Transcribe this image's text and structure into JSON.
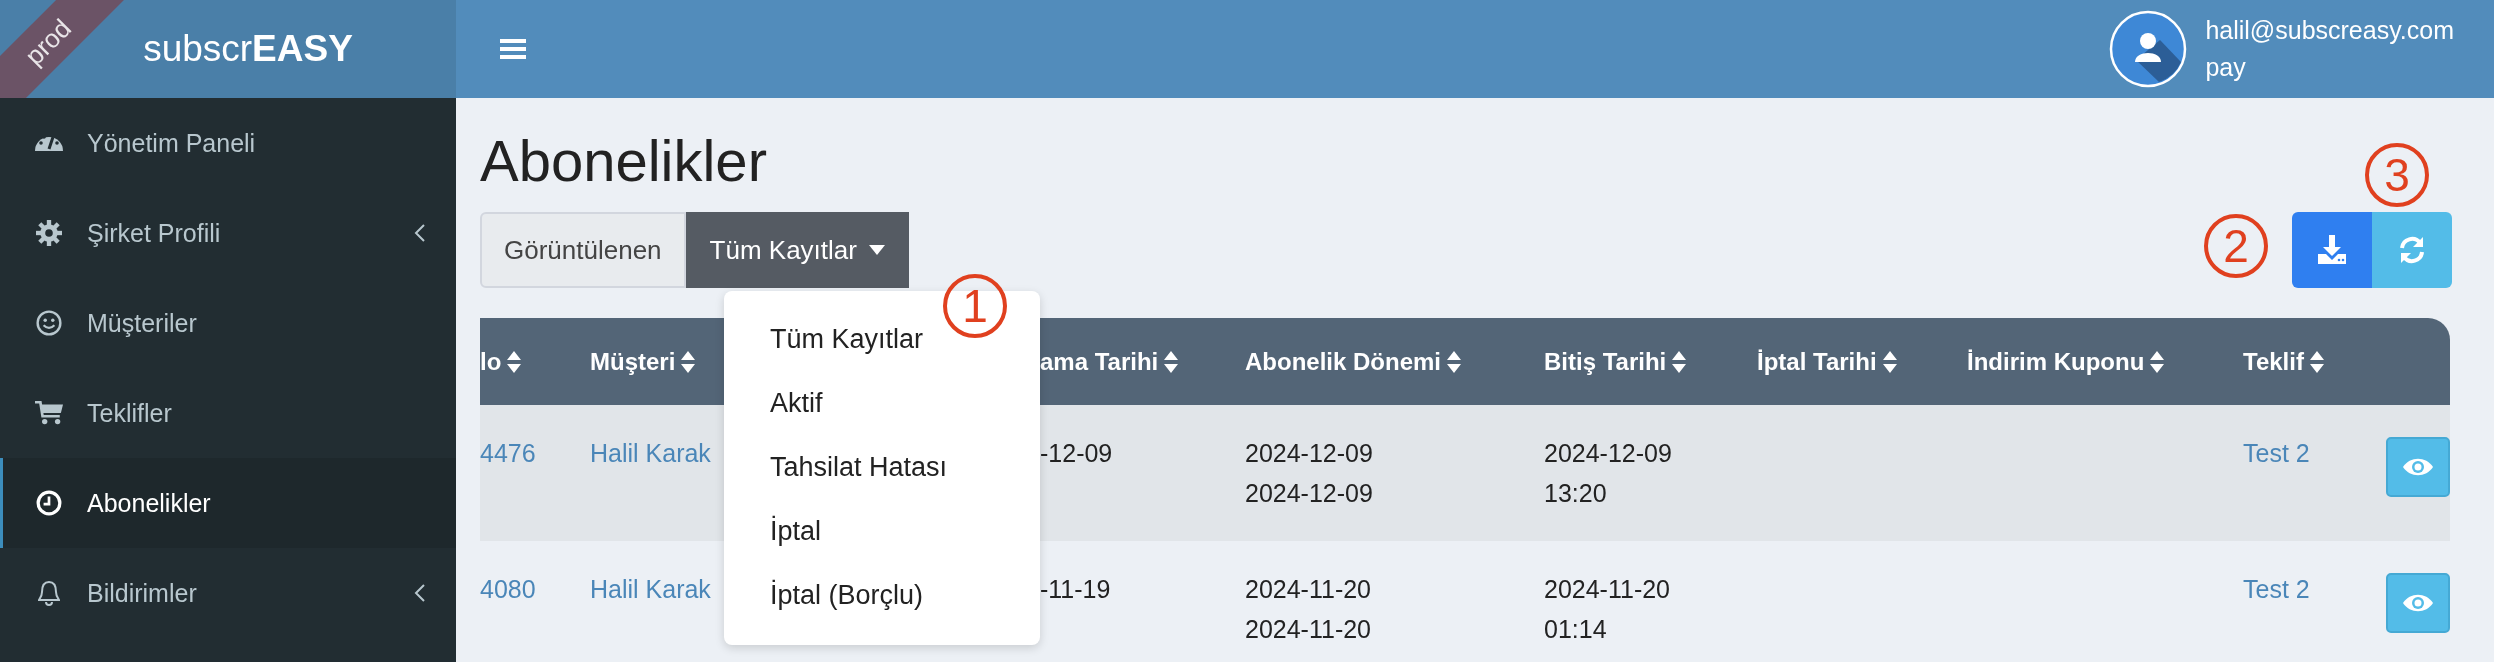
{
  "badge": "prod",
  "brand": "subscr**EASY**",
  "header": {
    "user_email": "halil@subscreasy.com",
    "user_role": "pay"
  },
  "sidebar": {
    "items": [
      {
        "label": "Yönetim Paneli",
        "selected": false,
        "has_submenu": false
      },
      {
        "label": "Şirket Profili",
        "selected": false,
        "has_submenu": true
      },
      {
        "label": "Müşteriler",
        "selected": false,
        "has_submenu": false
      },
      {
        "label": "Teklifler",
        "selected": false,
        "has_submenu": false
      },
      {
        "label": "Abonelikler",
        "selected": true,
        "has_submenu": false
      },
      {
        "label": "Bildirimler",
        "selected": false,
        "has_submenu": true
      }
    ]
  },
  "page_title": "Abonelikler",
  "view_toggle": [
    {
      "label": "Görüntülenen",
      "selected": false,
      "kind": "button"
    },
    {
      "label": "Tüm Kayıtlar",
      "selected": true,
      "kind": "dropdown"
    }
  ],
  "filter_menu": {
    "items": [
      "Tüm Kayıtlar",
      "Aktif",
      "Tahsilat Hatası",
      "İptal",
      "İptal (Borçlu)"
    ]
  },
  "annotations": [
    "1",
    "2",
    "3"
  ],
  "table": {
    "columns": [
      {
        "label": "lo",
        "sortable": true
      },
      {
        "label": "Müşteri",
        "sortable": true
      },
      {
        "label": "ama Tarihi",
        "sortable": true
      },
      {
        "label": "Abonelik Dönemi",
        "sortable": true
      },
      {
        "label": "Bitiş Tarihi",
        "sortable": true
      },
      {
        "label": "İptal Tarihi",
        "sortable": true
      },
      {
        "label": "İndirim Kuponu",
        "sortable": true
      },
      {
        "label": "Teklif",
        "sortable": true
      }
    ],
    "rows": [
      {
        "no": "4476",
        "customer": "Halil Karak",
        "start": "-12-09",
        "period": [
          "2024-12-09",
          "2024-12-09"
        ],
        "end": [
          "2024-12-09",
          "13:20"
        ],
        "offer": "Test 2"
      },
      {
        "no": "4080",
        "customer": "Halil Karak",
        "start": "-11-19",
        "period": [
          "2024-11-20",
          "2024-11-20"
        ],
        "end": [
          "2024-11-20",
          "01:14"
        ],
        "offer": "Test 2"
      }
    ]
  }
}
